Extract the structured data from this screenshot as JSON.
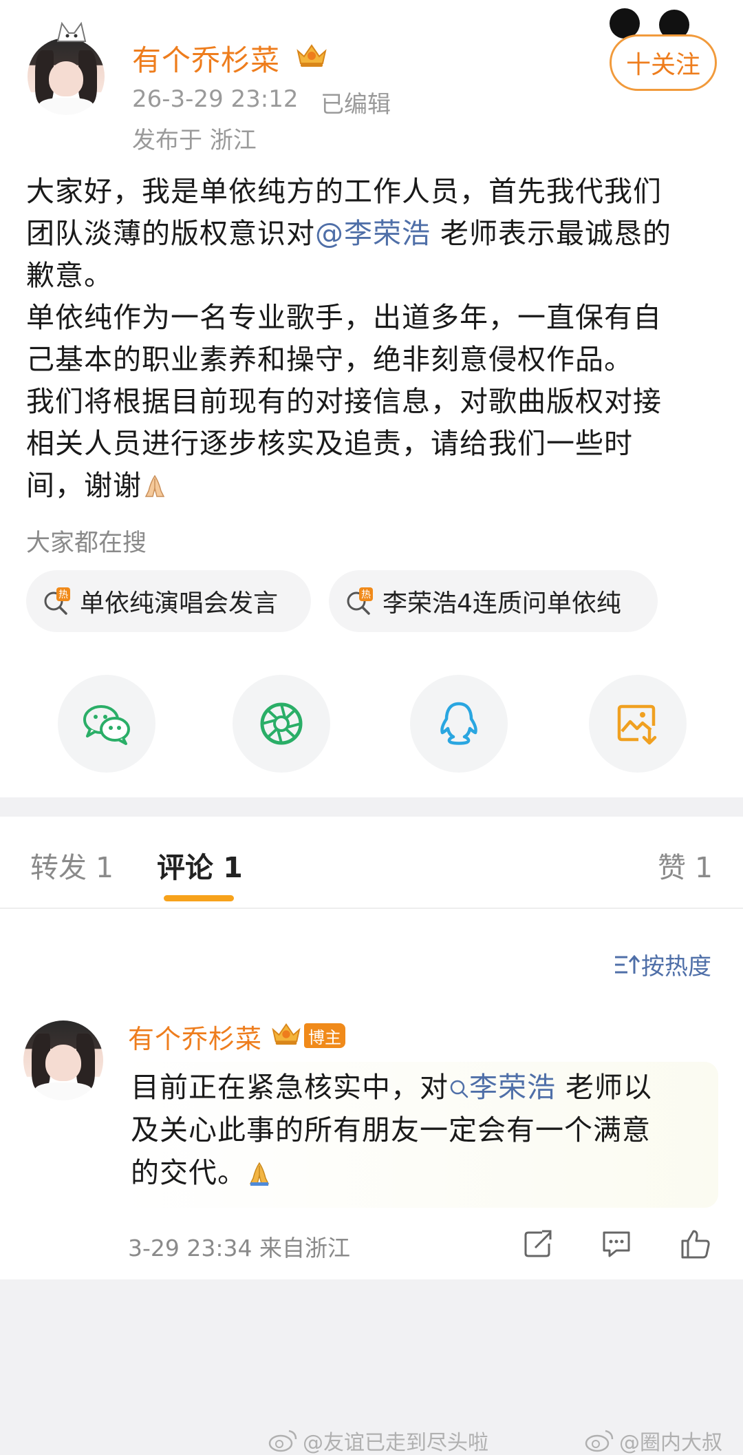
{
  "post": {
    "username": "有个乔杉菜",
    "time": "26-3-29 23:12",
    "edited": "已编辑",
    "location": "发布于 浙江",
    "follow_label": "十关注",
    "body_line1": "大家好，我是单依纯方的工作人员，首先我代我们",
    "body_line2a": "团队淡薄的版权意识对",
    "body_mention": "@李荣浩",
    "body_line2b": " 老师表示最诚恳的",
    "body_line3": "歉意。",
    "body_line4": "单依纯作为一名专业歌手，出道多年，一直保有自",
    "body_line5": "己基本的职业素养和操守，绝非刻意侵权作品。",
    "body_line6": "我们将根据目前现有的对接信息，对歌曲版权对接",
    "body_line7": "相关人员进行逐步核实及追责，请给我们一些时",
    "body_line8": "间，谢谢"
  },
  "search": {
    "heading": "大家都在搜",
    "chips": [
      {
        "label": "单依纯演唱会发言",
        "icon": "hot-search-icon"
      },
      {
        "label": "李荣浩4连质问单依纯",
        "icon": "hot-search-icon"
      }
    ]
  },
  "share": {
    "items": [
      "wechat-icon",
      "moments-icon",
      "qq-icon",
      "save-image-icon"
    ]
  },
  "tabs": {
    "repost": "转发 1",
    "comment": "评论 1",
    "like": "赞 1"
  },
  "comments": {
    "sort_label": "按热度",
    "items": [
      {
        "username": "有个乔杉菜",
        "badge": "博主",
        "text_a": "目前正在紧急核实中，对",
        "mention": "李荣浩",
        "text_b": " 老师以",
        "text_line2": "及关心此事的所有朋友一定会有一个满意",
        "text_line3": "的交代。",
        "time_location": "3-29 23:34 来自浙江"
      }
    ]
  },
  "watermarks": {
    "left": "@友谊已走到尽头啦",
    "right": "@圈内大叔"
  },
  "colors": {
    "accent": "#ee7d1d",
    "link": "#4f6fa8",
    "tab_indicator": "#f7a21b"
  }
}
